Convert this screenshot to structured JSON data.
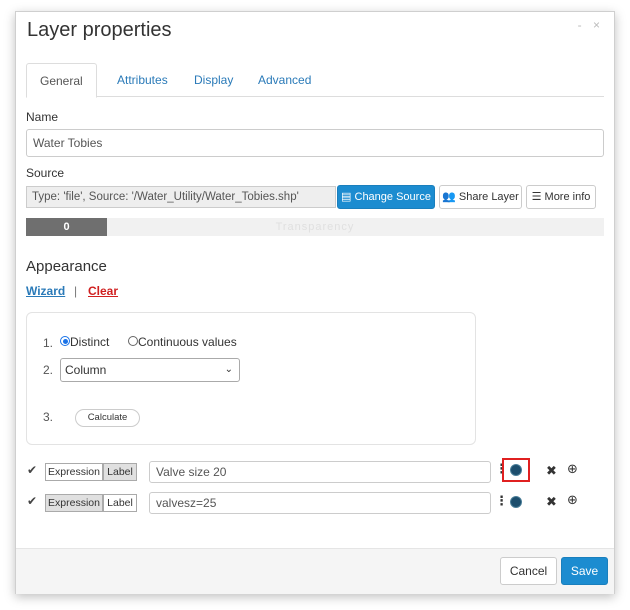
{
  "dialog": {
    "title": "Layer properties",
    "window_buttons": "- ×"
  },
  "tabs": [
    {
      "label": "General"
    },
    {
      "label": "Attributes"
    },
    {
      "label": "Display"
    },
    {
      "label": "Advanced"
    }
  ],
  "name_section": {
    "label": "Name",
    "value": "Water Tobies"
  },
  "source_section": {
    "label": "Source",
    "value": "Type: 'file', Source: '/Water_Utility/Water_Tobies.shp'",
    "change_source": "Change Source",
    "share_layer": "Share Layer",
    "more_info": "More info"
  },
  "transparency": {
    "value": "0",
    "label": "Transparency",
    "level": 0
  },
  "appearance": {
    "heading": "Appearance",
    "wizard": "Wizard",
    "separator": "|",
    "clear": "Clear"
  },
  "wizard": {
    "step1": "1.",
    "step2": "2.",
    "step3": "3.",
    "distinct": "Distinct",
    "continuous": "Continuous values",
    "column": "Column",
    "calculate": "Calculate"
  },
  "rules": [
    {
      "expression": "Expression",
      "label": "Label",
      "value": "Valve size 20",
      "active": "label"
    },
    {
      "expression": "Expression",
      "label": "Label",
      "value": "valvesz=25",
      "active": "expression"
    }
  ],
  "footer": {
    "cancel": "Cancel",
    "save": "Save"
  },
  "colors": {
    "primary": "#1c8cd0",
    "clear_red": "#d01f1f",
    "swatch": "#1c4e6d",
    "highlight": "#e02020"
  }
}
